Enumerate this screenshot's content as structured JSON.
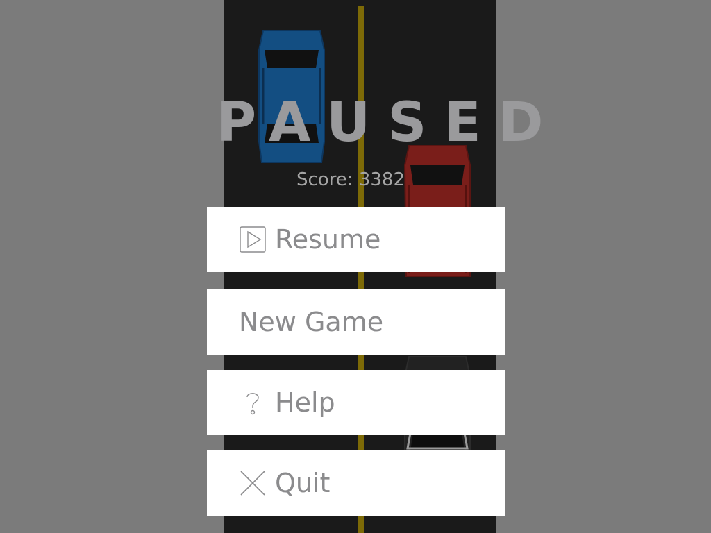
{
  "game": {
    "title": "PAUSED",
    "score_text": "Score: 3382"
  },
  "menu": {
    "resume_label": "Resume",
    "new_game_label": "New Game",
    "help_label": "Help",
    "quit_label": "Quit"
  },
  "icons": {
    "resume": "play-icon",
    "help": "question-icon",
    "quit": "close-icon"
  },
  "colors": {
    "background": "#7b7b7b",
    "road": "#1a1a1a",
    "lane_line": "#7d6a07",
    "car_blue": "#134e82",
    "car_red": "#7a1e1a",
    "button_bg": "#ffffff",
    "button_text": "#8b8b8d",
    "title_text": "#9a9a9c"
  }
}
